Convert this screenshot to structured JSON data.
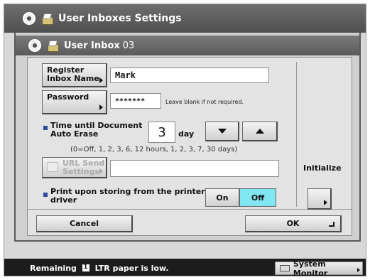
{
  "window": {
    "title": "User Inboxes Settings"
  },
  "panel": {
    "title": "User Inbox",
    "number": "03"
  },
  "register": {
    "button_line1": "Register",
    "button_line2": "Inbox Name",
    "value": "Mark"
  },
  "password": {
    "button_label": "Password",
    "value": "*******",
    "hint": "Leave blank if not required."
  },
  "auto_erase": {
    "label_line1": "Time until Document",
    "label_line2": "Auto Erase",
    "value": "3",
    "unit": "day",
    "options_hint": "(0=Off, 1, 2, 3, 6, 12 hours, 1, 2, 3, 7, 30 days)"
  },
  "url_send": {
    "button_line1": "URL Send",
    "button_line2": "Settings",
    "value": ""
  },
  "print_storing": {
    "label_line1": "Print upon storing from the printer",
    "label_line2": "driver",
    "on_label": "On",
    "off_label": "Off",
    "selected": "Off"
  },
  "initialize": {
    "label": "Initialize"
  },
  "footer": {
    "cancel_label": "Cancel",
    "ok_label": "OK"
  },
  "status": {
    "text_before": "Remaining",
    "text_after": "LTR paper is low.",
    "system_monitor_label": "System Monitor"
  },
  "colors": {
    "accent_blue": "#2d4c99",
    "selected_toggle": "#7fe6f2"
  }
}
